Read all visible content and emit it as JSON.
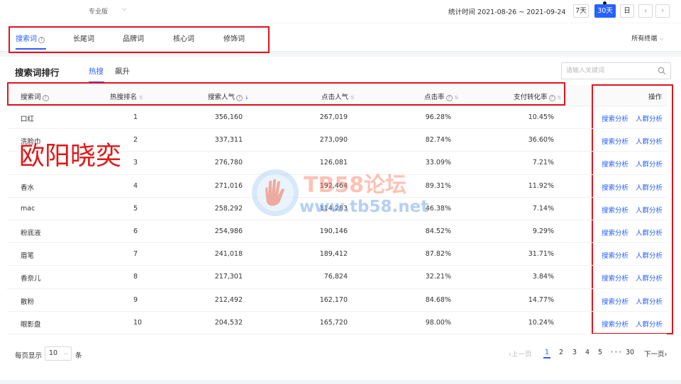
{
  "topbar": {
    "edition": "专业版",
    "stat_label": "统计时间 2021-08-26 ~ 2021-09-24",
    "range_buttons": [
      "7天",
      "30天",
      "日"
    ],
    "active_range": "30天"
  },
  "tabs": {
    "items": [
      "搜索词",
      "长尾词",
      "品牌词",
      "核心词",
      "修饰词"
    ],
    "active": "搜索词",
    "terminal": "所有终端"
  },
  "section": {
    "title": "搜索词排行",
    "subtabs": [
      "热搜",
      "飙升"
    ],
    "active_subtab": "热搜",
    "search_placeholder": "请输入关键词"
  },
  "table": {
    "columns": [
      "搜索词",
      "热搜排名",
      "搜索人气",
      "点击人气",
      "点击率",
      "支付转化率",
      "操作"
    ],
    "rows": [
      {
        "word": "口红",
        "rank": "1",
        "search_pop": "356,160",
        "click_pop": "267,019",
        "ctr": "96.28%",
        "cvr": "10.45%"
      },
      {
        "word": "洗脸巾",
        "rank": "2",
        "search_pop": "337,311",
        "click_pop": "273,090",
        "ctr": "82.74%",
        "cvr": "36.60%"
      },
      {
        "word": "",
        "rank": "3",
        "search_pop": "276,780",
        "click_pop": "126,081",
        "ctr": "33.09%",
        "cvr": "7.21%"
      },
      {
        "word": "香水",
        "rank": "4",
        "search_pop": "271,016",
        "click_pop": "192,464",
        "ctr": "89.31%",
        "cvr": "11.92%"
      },
      {
        "word": "mac",
        "rank": "5",
        "search_pop": "258,292",
        "click_pop": "114,283",
        "ctr": "46.38%",
        "cvr": "7.14%"
      },
      {
        "word": "粉底液",
        "rank": "6",
        "search_pop": "254,986",
        "click_pop": "190,146",
        "ctr": "84.52%",
        "cvr": "9.29%"
      },
      {
        "word": "眉笔",
        "rank": "7",
        "search_pop": "241,018",
        "click_pop": "189,412",
        "ctr": "87.82%",
        "cvr": "31.71%"
      },
      {
        "word": "香奈儿",
        "rank": "8",
        "search_pop": "217,301",
        "click_pop": "76,824",
        "ctr": "32.21%",
        "cvr": "3.84%"
      },
      {
        "word": "散粉",
        "rank": "9",
        "search_pop": "212,492",
        "click_pop": "162,170",
        "ctr": "84.68%",
        "cvr": "14.77%"
      },
      {
        "word": "眼影盘",
        "rank": "10",
        "search_pop": "204,532",
        "click_pop": "165,720",
        "ctr": "98.00%",
        "cvr": "10.24%"
      }
    ],
    "actions": [
      "搜索分析",
      "人群分析"
    ]
  },
  "overlay": {
    "name": "欧阳晓奕",
    "watermark_title": "TB58论坛",
    "watermark_url": "www.tb58.net"
  },
  "pagination": {
    "per_page_label": "每页显示",
    "per_page_value": "10",
    "per_page_unit": "条",
    "prev": "上一页",
    "pages": [
      "1",
      "2",
      "3",
      "4",
      "5"
    ],
    "ellipsis": "•••",
    "last_page": "30",
    "next": "下一页",
    "current": "1"
  },
  "colors": {
    "accent": "#2761ff",
    "annotation_red": "#e0141e"
  }
}
